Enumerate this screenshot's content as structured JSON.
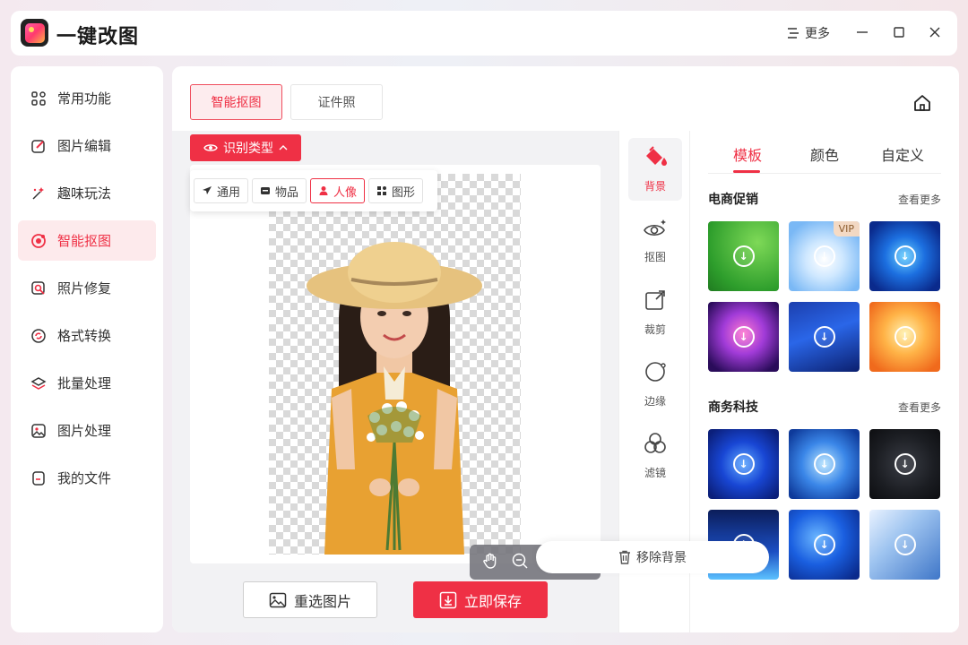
{
  "app": {
    "title": "一键改图",
    "more_label": "更多"
  },
  "sidebar": {
    "items": [
      {
        "label": "常用功能",
        "icon": "grid-icon"
      },
      {
        "label": "图片编辑",
        "icon": "edit-icon"
      },
      {
        "label": "趣味玩法",
        "icon": "sparkle-icon"
      },
      {
        "label": "智能抠图",
        "icon": "cutout-icon",
        "active": true
      },
      {
        "label": "照片修复",
        "icon": "repair-icon"
      },
      {
        "label": "格式转换",
        "icon": "convert-icon"
      },
      {
        "label": "批量处理",
        "icon": "layers-icon"
      },
      {
        "label": "图片处理",
        "icon": "image-icon"
      },
      {
        "label": "我的文件",
        "icon": "file-icon"
      }
    ]
  },
  "main": {
    "tabs": [
      {
        "label": "智能抠图",
        "active": true
      },
      {
        "label": "证件照"
      }
    ],
    "recognize_label": "识别类型",
    "types": [
      {
        "label": "通用"
      },
      {
        "label": "物品"
      },
      {
        "label": "人像",
        "active": true
      },
      {
        "label": "图形"
      }
    ],
    "reselect_label": "重选图片",
    "save_label": "立即保存"
  },
  "tools": [
    {
      "label": "背景",
      "icon": "paint-bucket-icon",
      "active": true
    },
    {
      "label": "抠图",
      "icon": "eye-sparkle-icon"
    },
    {
      "label": "裁剪",
      "icon": "crop-icon"
    },
    {
      "label": "边缘",
      "icon": "edge-icon"
    },
    {
      "label": "滤镜",
      "icon": "filter-icon"
    }
  ],
  "panel": {
    "tabs": [
      {
        "label": "模板",
        "active": true
      },
      {
        "label": "颜色"
      },
      {
        "label": "自定义"
      }
    ],
    "sections": [
      {
        "title": "电商促销",
        "see_more": "查看更多"
      },
      {
        "title": "商务科技",
        "see_more": "查看更多"
      }
    ],
    "vip_label": "VIP",
    "remove_bg_label": "移除背景"
  },
  "colors": {
    "accent": "#ef3045",
    "accent_light": "#fdeaec"
  }
}
